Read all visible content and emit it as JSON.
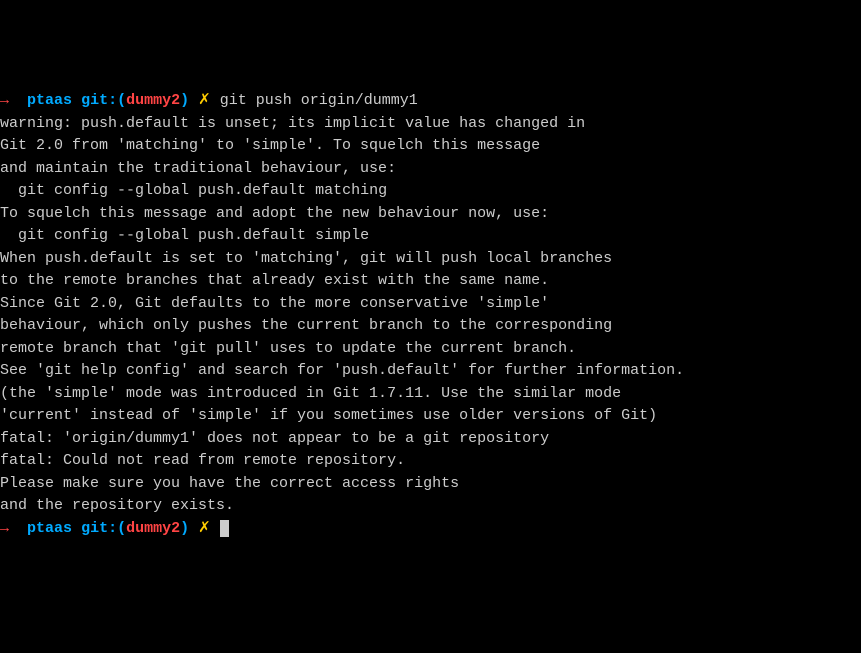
{
  "prompt1": {
    "arrow": "→",
    "dir": "ptaas",
    "git_label": "git:(",
    "branch": "dummy2",
    "git_close": ")",
    "symbol": "✗",
    "command": "git push origin/dummy1"
  },
  "output": {
    "line1": "warning: push.default is unset; its implicit value has changed in",
    "line2": "Git 2.0 from 'matching' to 'simple'. To squelch this message",
    "line3": "and maintain the traditional behaviour, use:",
    "line4": "",
    "line5": "  git config --global push.default matching",
    "line6": "",
    "line7": "To squelch this message and adopt the new behaviour now, use:",
    "line8": "",
    "line9": "  git config --global push.default simple",
    "line10": "",
    "line11": "When push.default is set to 'matching', git will push local branches",
    "line12": "to the remote branches that already exist with the same name.",
    "line13": "",
    "line14": "Since Git 2.0, Git defaults to the more conservative 'simple'",
    "line15": "behaviour, which only pushes the current branch to the corresponding",
    "line16": "remote branch that 'git pull' uses to update the current branch.",
    "line17": "",
    "line18": "See 'git help config' and search for 'push.default' for further information.",
    "line19": "(the 'simple' mode was introduced in Git 1.7.11. Use the similar mode",
    "line20": "'current' instead of 'simple' if you sometimes use older versions of Git)",
    "line21": "",
    "line22": "fatal: 'origin/dummy1' does not appear to be a git repository",
    "line23": "fatal: Could not read from remote repository.",
    "line24": "",
    "line25": "Please make sure you have the correct access rights",
    "line26": "and the repository exists."
  },
  "prompt2": {
    "arrow": "→",
    "dir": "ptaas",
    "git_label": "git:(",
    "branch": "dummy2",
    "git_close": ")",
    "symbol": "✗"
  }
}
